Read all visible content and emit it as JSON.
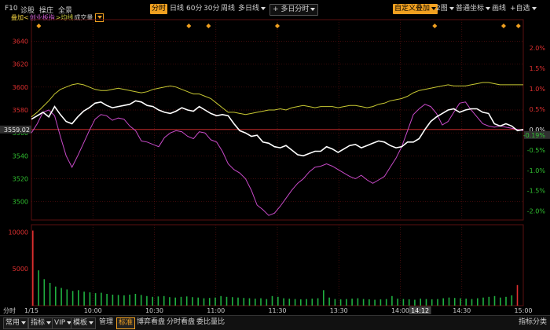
{
  "toolbar": {
    "left_items": [
      "F10",
      "诊股",
      "操庄",
      "全景"
    ],
    "periods": [
      "分时",
      "日线",
      "60分",
      "30分",
      "周线",
      "多日线"
    ],
    "active_period": "分时",
    "multi_day": "多日分时",
    "custom_indicator": "自定义叠加",
    "layout": "2图",
    "coord": "普通坐标",
    "draw": "画线",
    "add_watch": "+自选"
  },
  "legend": {
    "overlay": "叠加<",
    "index_name": "创业板指",
    "avg_line": ">均线",
    "volume": "成交量"
  },
  "colors": {
    "price_line": "#ffffff",
    "avg_line": "#c8c832",
    "index_line": "#c84ac8",
    "grid": "#5a1010",
    "axis_text": "#c8c8c8",
    "positive": "#e03030",
    "negative": "#30c030",
    "accent": "#f0a020",
    "volume_bar": "#20b040"
  },
  "chart_data": {
    "type": "line",
    "y_price_ticks": [
      "3640",
      "3620",
      "3600",
      "3580",
      "3560",
      "3540",
      "3520",
      "3500"
    ],
    "y_pct_ticks": [
      "2.0%",
      "1.5%",
      "1.0%",
      "0.5%",
      "0.0%",
      "-0.5%",
      "-1.0%",
      "-1.5%",
      "-2.0%"
    ],
    "ylim": [
      3484,
      3652
    ],
    "prev_close": 3563,
    "current_value": "3559.02",
    "current_pct": "-0.19%",
    "volume_label": "10000",
    "volume_ticks": [
      "10000",
      "5000"
    ],
    "volume_ylim": [
      0,
      11000
    ],
    "x_ticks": [
      "1/15",
      "10:00",
      "10:30",
      "11:00",
      "11:30",
      "13:30",
      "14:00",
      "14:30",
      "15:00"
    ],
    "x_axis_left": "分时",
    "crosshair_time": "14:12",
    "series": [
      {
        "name": "价格",
        "values": [
          3572,
          3575,
          3578,
          3574,
          3583,
          3576,
          3570,
          3568,
          3574,
          3579,
          3582,
          3586,
          3587,
          3584,
          3582,
          3583,
          3584,
          3585,
          3588,
          3587,
          3584,
          3583,
          3580,
          3578,
          3577,
          3579,
          3582,
          3580,
          3579,
          3583,
          3580,
          3577,
          3575,
          3576,
          3575,
          3568,
          3562,
          3560,
          3557,
          3558,
          3552,
          3551,
          3548,
          3547,
          3549,
          3545,
          3541,
          3540,
          3542,
          3544,
          3544,
          3548,
          3546,
          3543,
          3546,
          3549,
          3550,
          3547,
          3549,
          3551,
          3553,
          3552,
          3549,
          3547,
          3548,
          3552,
          3552,
          3555,
          3563,
          3570,
          3574,
          3577,
          3580,
          3581,
          3578,
          3580,
          3581,
          3581,
          3578,
          3577,
          3568,
          3566,
          3568,
          3566,
          3562,
          3563
        ]
      },
      {
        "name": "均线",
        "values": [
          3574,
          3578,
          3583,
          3588,
          3594,
          3598,
          3600,
          3602,
          3603,
          3602,
          3600,
          3598,
          3597,
          3597,
          3598,
          3599,
          3598,
          3597,
          3596,
          3595,
          3596,
          3598,
          3599,
          3600,
          3601,
          3600,
          3598,
          3596,
          3594,
          3594,
          3592,
          3590,
          3586,
          3582,
          3578,
          3578,
          3577,
          3576,
          3577,
          3578,
          3579,
          3580,
          3580,
          3581,
          3580,
          3582,
          3583,
          3584,
          3583,
          3582,
          3583,
          3583,
          3583,
          3582,
          3583,
          3584,
          3584,
          3583,
          3582,
          3583,
          3585,
          3586,
          3588,
          3589,
          3590,
          3592,
          3595,
          3597,
          3598,
          3599,
          3600,
          3601,
          3602,
          3601,
          3601,
          3601,
          3602,
          3603,
          3604,
          3604,
          3603,
          3602,
          3602,
          3602,
          3602,
          3602
        ]
      },
      {
        "name": "创业板指",
        "values": [
          3560,
          3568,
          3578,
          3580,
          3575,
          3557,
          3540,
          3530,
          3540,
          3551,
          3562,
          3572,
          3576,
          3575,
          3571,
          3573,
          3572,
          3566,
          3562,
          3553,
          3552,
          3550,
          3548,
          3556,
          3560,
          3562,
          3561,
          3557,
          3555,
          3561,
          3560,
          3554,
          3552,
          3544,
          3533,
          3528,
          3525,
          3520,
          3510,
          3497,
          3493,
          3488,
          3490,
          3496,
          3503,
          3510,
          3516,
          3520,
          3526,
          3530,
          3531,
          3533,
          3531,
          3528,
          3525,
          3522,
          3520,
          3523,
          3519,
          3516,
          3519,
          3522,
          3530,
          3538,
          3548,
          3562,
          3576,
          3581,
          3585,
          3583,
          3577,
          3567,
          3570,
          3578,
          3586,
          3587,
          3580,
          3574,
          3568,
          3566,
          3565,
          3566,
          3565,
          3564,
          3563,
          3562
        ]
      }
    ],
    "volumes": [
      10200,
      4800,
      3600,
      3100,
      2600,
      2400,
      2200,
      2000,
      2100,
      1900,
      1800,
      1700,
      1750,
      1600,
      1500,
      1450,
      1400,
      1500,
      1600,
      1450,
      1300,
      1200,
      1250,
      1300,
      1150,
      1100,
      1200,
      1250,
      1150,
      1100,
      1000,
      1050,
      1100,
      1300,
      1200,
      1150,
      1100,
      1050,
      1000,
      950,
      1000,
      900,
      1300,
      1200,
      1000,
      950,
      900,
      850,
      900,
      950,
      1000,
      2100,
      1100,
      900,
      850,
      900,
      950,
      1000,
      900,
      850,
      800,
      850,
      900,
      1300,
      950,
      900,
      850,
      800,
      950,
      900,
      850,
      900,
      1000,
      1100,
      1050,
      1000,
      950,
      900,
      1000,
      1100,
      1200,
      1300,
      1100,
      1200,
      1400,
      2800
    ]
  },
  "bottom_bar": {
    "items": [
      "常用",
      "指标",
      "VIP",
      "模板",
      "管理",
      "标准",
      "博弈看盘",
      "分时看盘",
      "委比量比"
    ],
    "right_item": "指标分类"
  }
}
